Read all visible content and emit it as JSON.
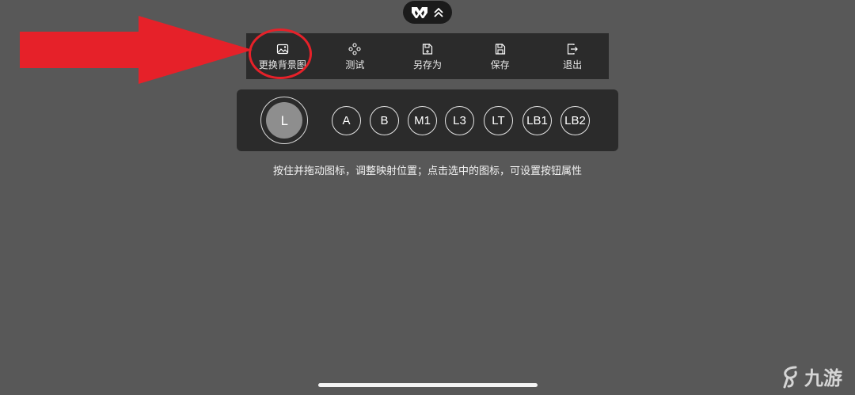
{
  "toolbar": {
    "items": [
      {
        "label": "更换背景图",
        "icon": "image-icon"
      },
      {
        "label": "测试",
        "icon": "dpad-icon"
      },
      {
        "label": "另存为",
        "icon": "save-as-icon"
      },
      {
        "label": "保存",
        "icon": "save-icon"
      },
      {
        "label": "退出",
        "icon": "exit-icon"
      }
    ]
  },
  "buttons": {
    "stick": "L",
    "keys": [
      "A",
      "B",
      "M1",
      "L3",
      "LT",
      "LB1",
      "LB2"
    ]
  },
  "hint": "按住并拖动图标，调整映射位置；点击选中的图标，可设置按钮属性",
  "watermark": "九游",
  "colors": {
    "background": "#585858",
    "panel": "#2b2b2b",
    "annotation_red": "#e62129"
  }
}
